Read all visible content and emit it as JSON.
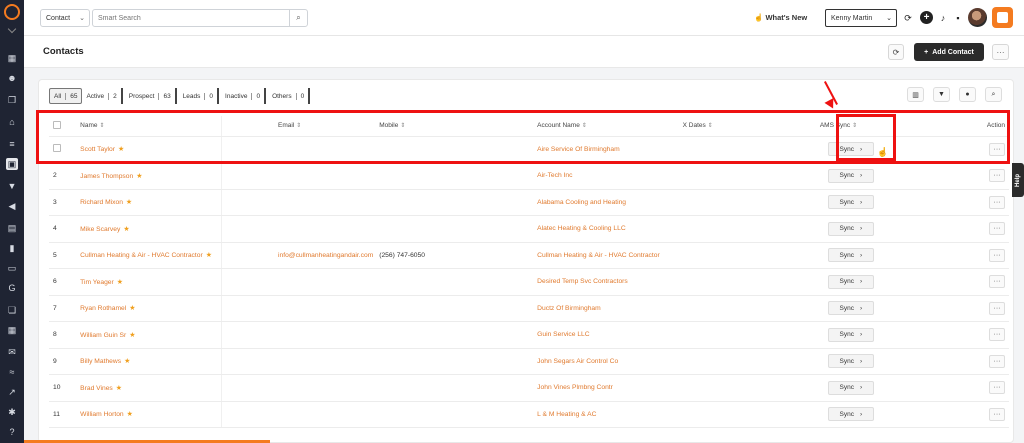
{
  "topbar": {
    "search_type": "Contact",
    "search_placeholder": "Smart Search",
    "whats_new": "What's New",
    "user": "Kenny Martin"
  },
  "header": {
    "title": "Contacts",
    "add_contact": "Add Contact"
  },
  "filters": [
    {
      "label": "All",
      "count": "65"
    },
    {
      "label": "Active",
      "count": "2"
    },
    {
      "label": "Prospect",
      "count": "63"
    },
    {
      "label": "Leads",
      "count": "0"
    },
    {
      "label": "Inactive",
      "count": "0"
    },
    {
      "label": "Others",
      "count": "0"
    }
  ],
  "columns": {
    "name": "Name",
    "email": "Email",
    "mobile": "Mobile",
    "account": "Account Name",
    "xdates": "X Dates",
    "ams_sync": "AMS Sync",
    "action": "Action"
  },
  "sync_label": "Sync",
  "help_label": "Help",
  "rows": [
    {
      "num": "",
      "name": "Scott Taylor",
      "email": "",
      "mobile": "",
      "account": "Aire Service Of Birmingham"
    },
    {
      "num": "2",
      "name": "James Thompson",
      "email": "",
      "mobile": "",
      "account": "Air-Tech Inc"
    },
    {
      "num": "3",
      "name": "Richard Mixon",
      "email": "",
      "mobile": "",
      "account": "Alabama Cooling and Heating"
    },
    {
      "num": "4",
      "name": "Mike Scarvey",
      "email": "",
      "mobile": "",
      "account": "Alatec Heating & Cooling LLC"
    },
    {
      "num": "5",
      "name": "Cullman Heating & Air - HVAC Contractor",
      "email": "info@cullmanheatingandair.com",
      "mobile": "(256) 747-6050",
      "account": "Cullman Heating & Air - HVAC Contractor"
    },
    {
      "num": "6",
      "name": "Tim Yeager",
      "email": "",
      "mobile": "",
      "account": "Desired Temp Svc Contractors"
    },
    {
      "num": "7",
      "name": "Ryan Rothamel",
      "email": "",
      "mobile": "",
      "account": "Ductz Of Birmingham"
    },
    {
      "num": "8",
      "name": "William Guin Sr",
      "email": "",
      "mobile": "",
      "account": "Guin Service LLC"
    },
    {
      "num": "9",
      "name": "Billy Mathews",
      "email": "",
      "mobile": "",
      "account": "John Segars Air Control Co"
    },
    {
      "num": "10",
      "name": "Brad Vines",
      "email": "",
      "mobile": "",
      "account": "John Vines Plmbng Contr"
    },
    {
      "num": "11",
      "name": "William Horton",
      "email": "",
      "mobile": "",
      "account": "L & M Heating & AC"
    }
  ]
}
